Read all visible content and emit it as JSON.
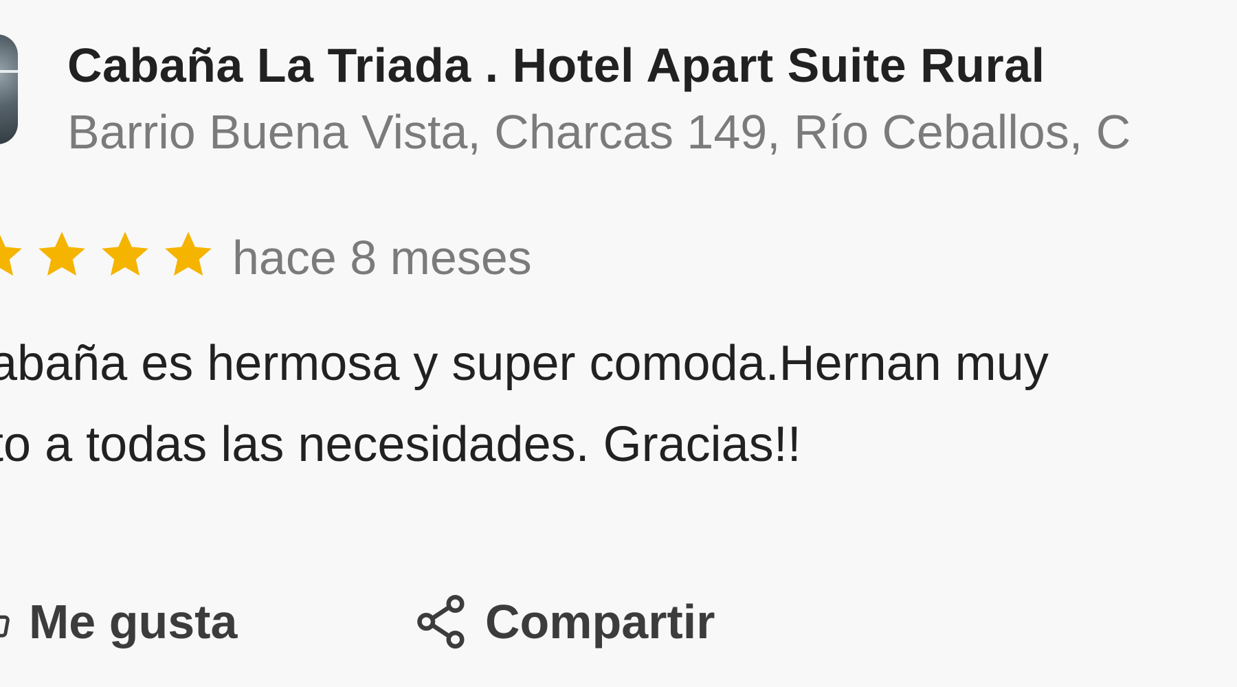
{
  "place": {
    "name": "Cabaña La Triada . Hotel Apart Suite Rural",
    "address": "Barrio Buena Vista, Charcas 149, Río Ceballos, C"
  },
  "review": {
    "rating": 5,
    "rating_max": 5,
    "star_color": "#f4b400",
    "time_ago": "hace 8 meses",
    "text_line_1": "abaña es hermosa y super comoda.Hernan muy",
    "text_line_2": "nto a todas las necesidades. Gracias!!"
  },
  "actions": {
    "like_label": "Me gusta",
    "like_icon": "thumb-up-icon",
    "share_label": "Compartir",
    "share_icon": "share-icon"
  }
}
